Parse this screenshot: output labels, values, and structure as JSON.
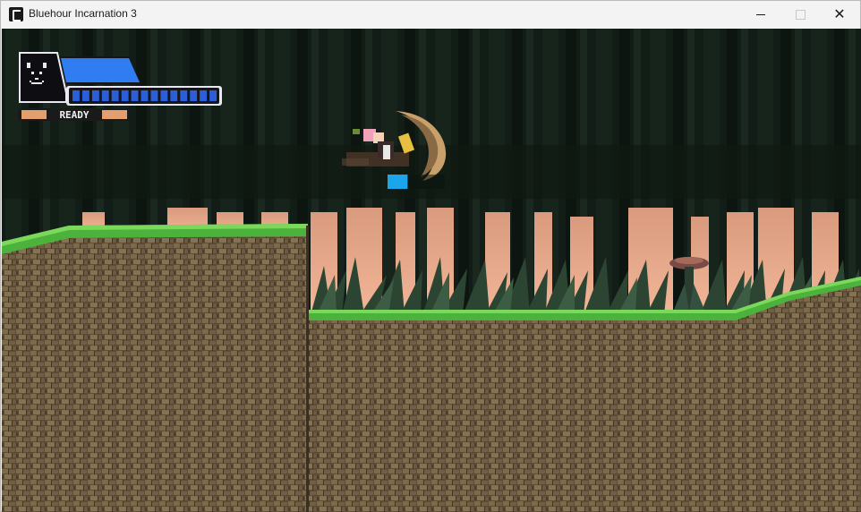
{
  "window": {
    "title": "Bluehour Incarnation 3",
    "controls": {
      "minimize": "minimize",
      "maximize": "maximize",
      "close": "close"
    }
  },
  "hud": {
    "portrait": "black-cat-face-icon",
    "status_text": "READY",
    "health_fraction": 1.0,
    "energy_segments_filled": 15,
    "energy_segments_total": 15,
    "colors": {
      "health": "#2f7df0",
      "energy": "#2a5fd8",
      "status_bar": "#e3a06e",
      "hud_frame": "#1d1d1d"
    }
  },
  "scene": {
    "player": "girl-on-crescent-moon-sprite",
    "enemy": "mushroom-plant-enemy",
    "player_gauge_fraction": 0.35,
    "colors": {
      "sky_glow": "#e8a98a",
      "tree_dark": "#0f1812",
      "grass": "#4bb23c",
      "dirt": "#6b5a40",
      "fern": "#2d4634",
      "gauge": "#1aa6e8"
    }
  }
}
